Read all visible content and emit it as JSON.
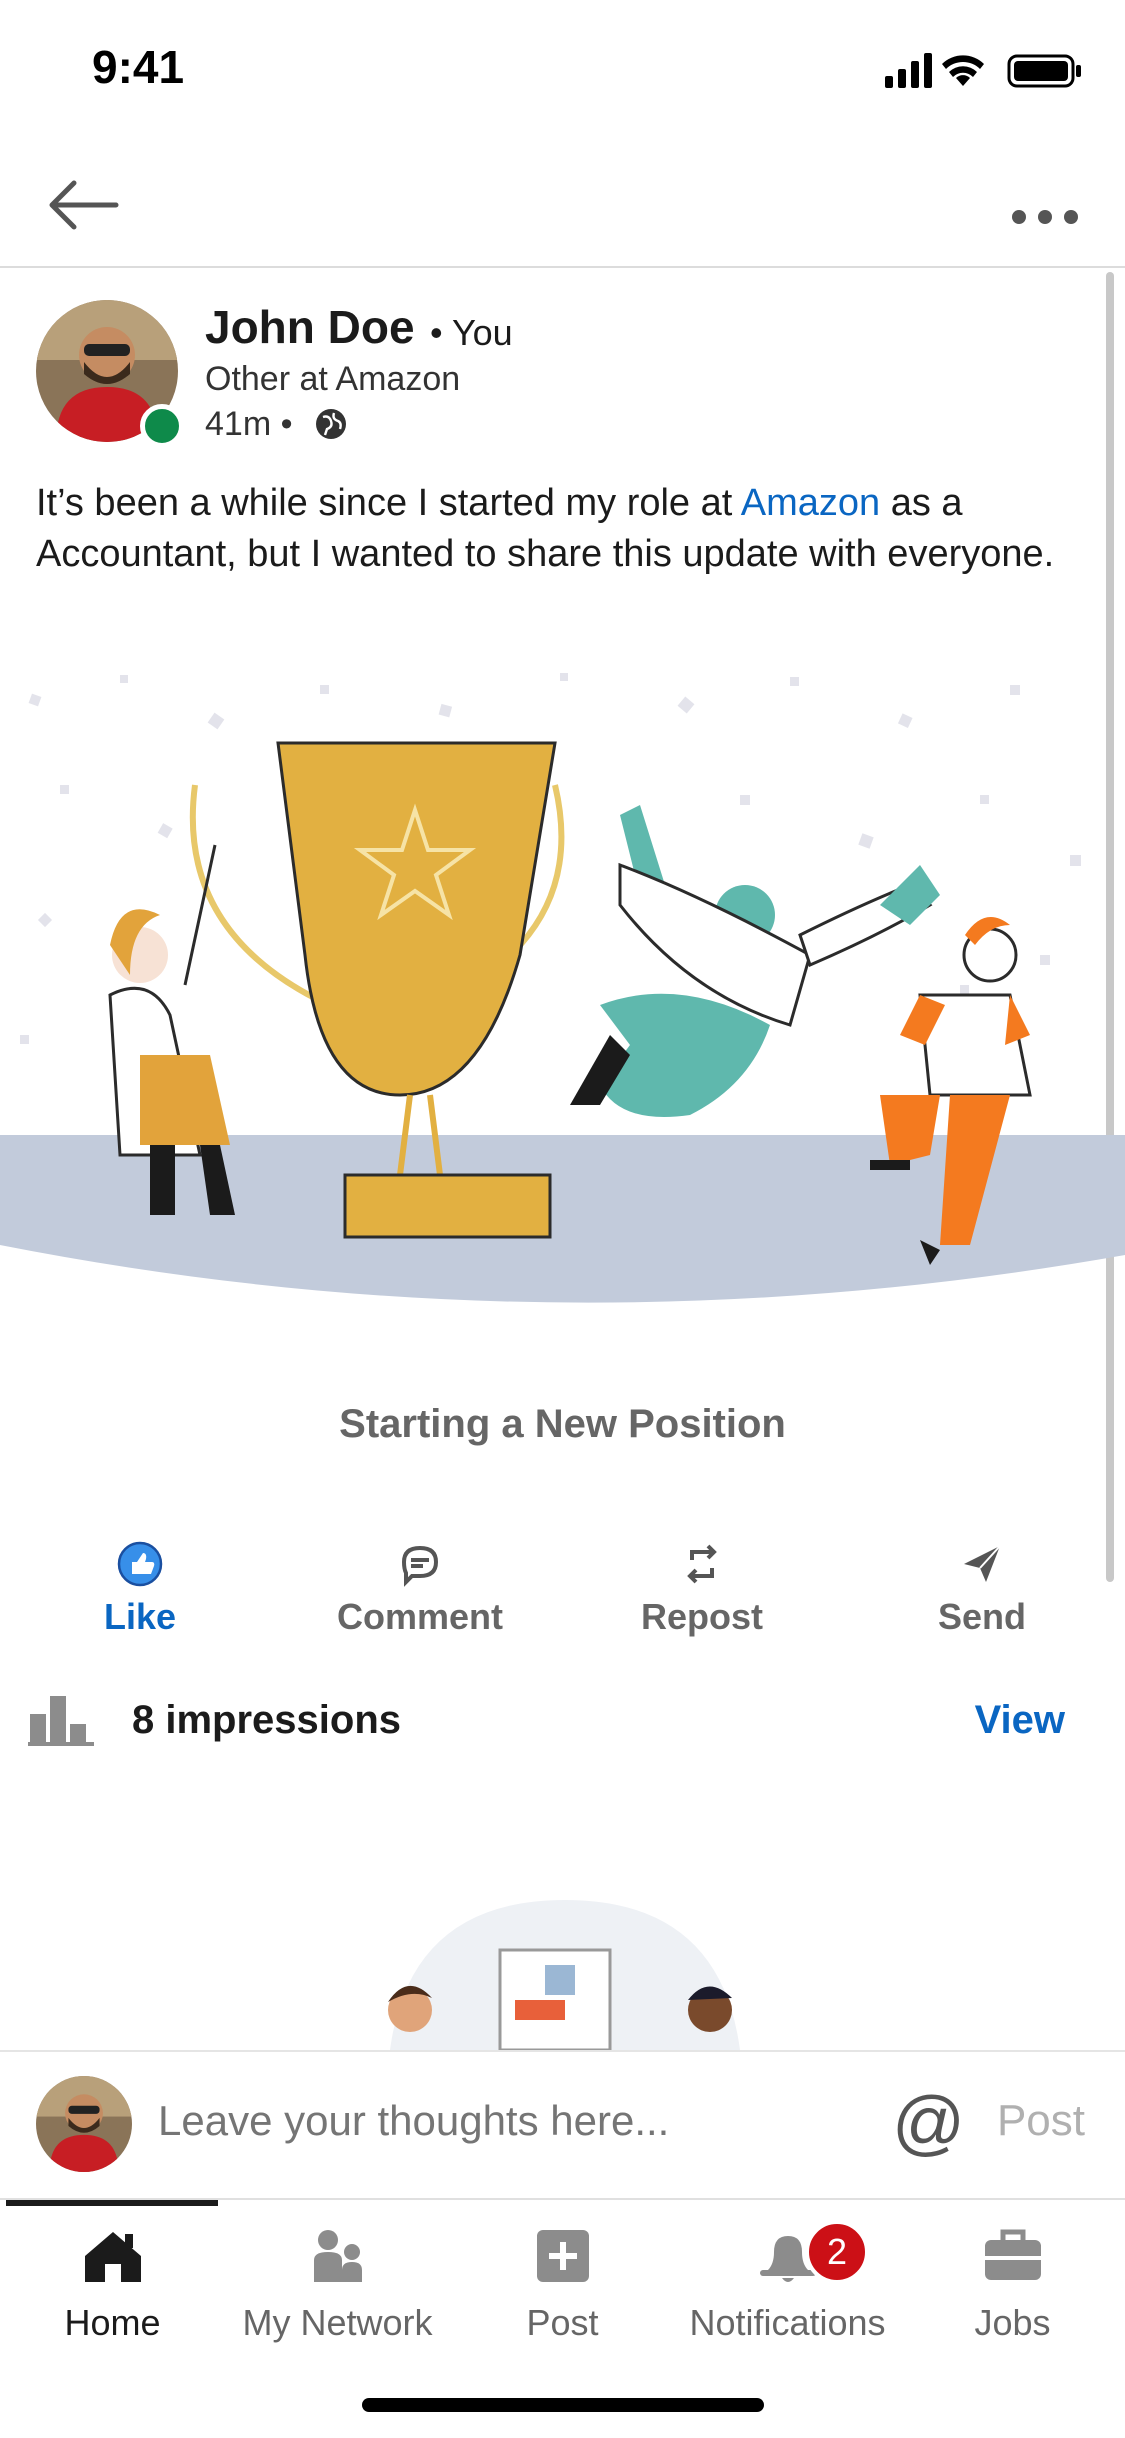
{
  "status_bar": {
    "time": "9:41"
  },
  "post": {
    "author_name": "John Doe",
    "author_badge": "• You",
    "author_headline": "Other at Amazon",
    "time_ago": "41m •",
    "text_before": "It’s been a while since I started my role at ",
    "text_mention": "Amazon",
    "text_after": " as a Accountant, but I wanted to share this update with everyone.",
    "illustration_caption": "Starting a New Position"
  },
  "actions": {
    "like": "Like",
    "comment": "Comment",
    "repost": "Repost",
    "send": "Send"
  },
  "impressions": {
    "text": "8 impressions",
    "view_label": "View"
  },
  "comment_bar": {
    "placeholder": "Leave your thoughts here...",
    "at_symbol": "@",
    "post_label": "Post"
  },
  "tabs": {
    "home": "Home",
    "network": "My Network",
    "post": "Post",
    "notifications": "Notifications",
    "notifications_badge": "2",
    "jobs": "Jobs"
  },
  "colors": {
    "accent": "#0a66c2",
    "badge": "#cc1016",
    "online": "#0e8a4a",
    "trophy": "#e2b041"
  }
}
